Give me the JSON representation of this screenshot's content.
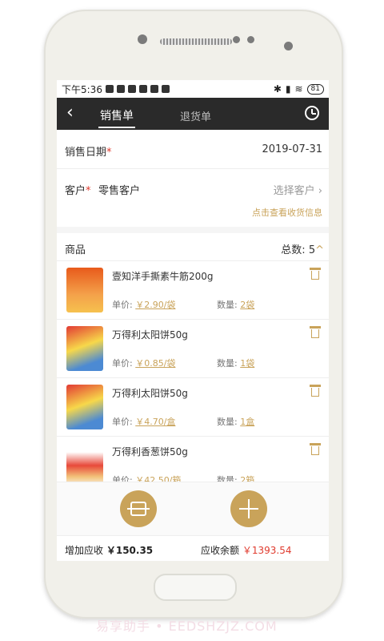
{
  "status_bar": {
    "time": "下午5:36",
    "battery": "81"
  },
  "nav": {
    "tabs": [
      {
        "label": "销售单",
        "active": true
      },
      {
        "label": "退货单",
        "active": false
      }
    ]
  },
  "form": {
    "date_label": "销售日期",
    "required_mark": "*",
    "date_value": "2019-07-31",
    "customer_label": "客户",
    "customer_value": "零售客户",
    "customer_action": "选择客户",
    "receipt_link": "点击查看收货信息"
  },
  "goods": {
    "header": "商品",
    "total_label": "总数:",
    "total_value": "5",
    "items": [
      {
        "name": "壹知洋手撕素牛筋200g",
        "price_label": "单价:",
        "price": "￥2.90/袋",
        "qty_label": "数量:",
        "qty": "2袋"
      },
      {
        "name": "万得利太阳饼50g",
        "price_label": "单价:",
        "price": "￥0.85/袋",
        "qty_label": "数量:",
        "qty": "1袋"
      },
      {
        "name": "万得利太阳饼50g",
        "price_label": "单价:",
        "price": "￥4.70/盒",
        "qty_label": "数量:",
        "qty": "1盒"
      },
      {
        "name": "万得利香葱饼50g",
        "price_label": "单价:",
        "price": "￥42.50/箱",
        "qty_label": "数量:",
        "qty": "2箱"
      }
    ]
  },
  "footer": {
    "added_label": "增加应收",
    "added_value": "￥150.35",
    "balance_label": "应收余额",
    "balance_value": "￥1393.54"
  },
  "watermark": "易享助手 • EEDSHZJZ.COM",
  "colors": {
    "accent": "#c9a35a",
    "nav": "#2a2a2a",
    "alert": "#e03b2e"
  }
}
